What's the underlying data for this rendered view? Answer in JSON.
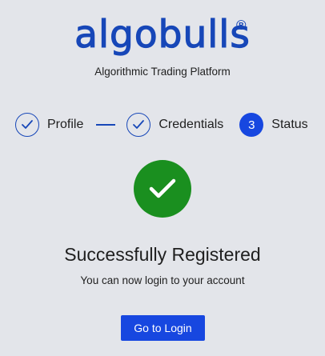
{
  "brand": {
    "logo_text": "algobulls",
    "registered_mark": "®",
    "tagline": "Algorithmic Trading Platform",
    "color": "#1747b8"
  },
  "stepper": {
    "steps": [
      {
        "label": "Profile",
        "state": "completed",
        "icon": "check-icon"
      },
      {
        "label": "Credentials",
        "state": "completed",
        "icon": "check-icon"
      },
      {
        "label": "Status",
        "state": "active",
        "number": "3"
      }
    ],
    "active_color": "#1747e0"
  },
  "result": {
    "icon": "check-icon",
    "icon_color": "#1a8f1f",
    "title": "Successfully Registered",
    "message": "You can now login to your account"
  },
  "actions": {
    "login_label": "Go to Login"
  }
}
